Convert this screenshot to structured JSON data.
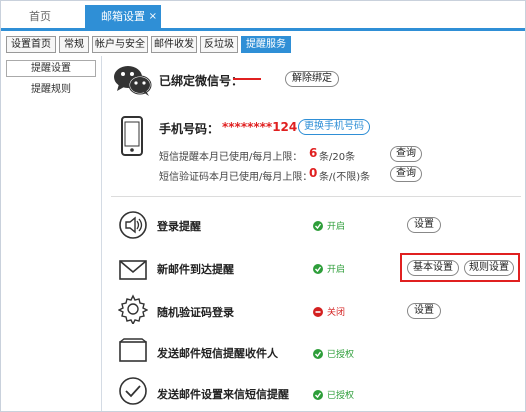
{
  "tabs": {
    "home": "首页",
    "active": "邮箱设置",
    "close": "×"
  },
  "subtabs": [
    "设置首页",
    "常规",
    "帐户与安全",
    "邮件收发",
    "反垃圾",
    "提醒服务"
  ],
  "sidebar": {
    "items": [
      "提醒设置",
      "提醒规则"
    ]
  },
  "wechat": {
    "label": "已绑定微信号：",
    "unbind": "解除绑定"
  },
  "phone": {
    "label": "手机号码：",
    "number": "********124",
    "change": "更换手机号码",
    "sms_label": "短信提醒本月已使用/每月上限：",
    "sms_used": "6",
    "sms_limit": "条/20条",
    "sms_query": "查询",
    "code_label": "短信验证码本月已使用/每月上限：",
    "code_used": "0",
    "code_limit": "条/(不限)条",
    "code_query": "查询"
  },
  "rows": [
    {
      "title": "登录提醒",
      "status": "开启",
      "state": "on",
      "btn": "设置"
    },
    {
      "title": "新邮件到达提醒",
      "status": "开启",
      "state": "on",
      "btn1": "基本设置",
      "btn2": "规则设置"
    },
    {
      "title": "随机验证码登录",
      "status": "关闭",
      "state": "off",
      "btn": "设置"
    },
    {
      "title": "发送邮件短信提醒收件人",
      "status": "已授权",
      "state": "on"
    },
    {
      "title": "发送邮件设置来信短信提醒",
      "status": "已授权",
      "state": "on"
    }
  ],
  "colors": {
    "accent": "#2f8fd6",
    "on": "#2e9e3a",
    "off": "#d42020",
    "highlight": "#e02020"
  }
}
